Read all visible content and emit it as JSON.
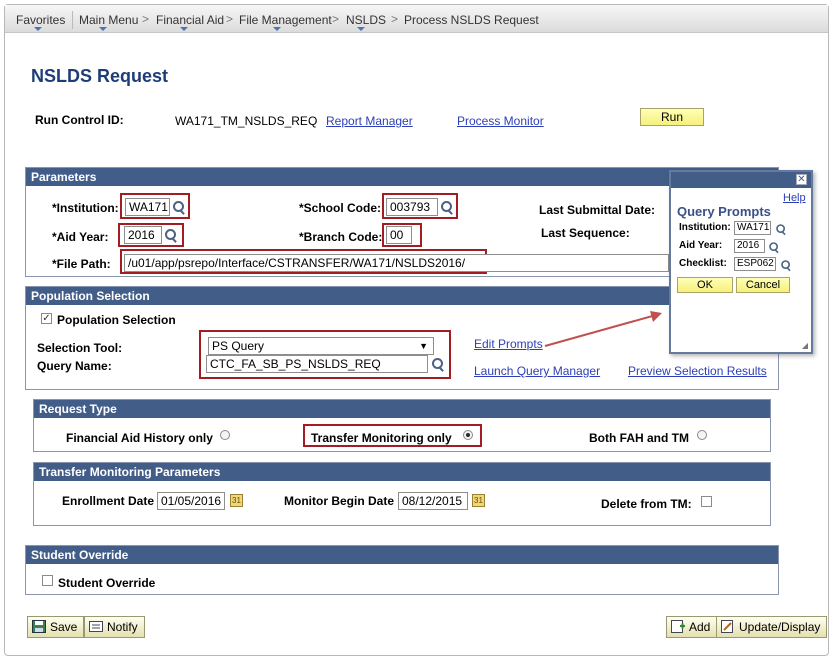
{
  "breadcrumb": {
    "items": [
      "Favorites",
      "Main Menu",
      "Financial Aid",
      "File Management",
      "NSLDS",
      "Process NSLDS Request"
    ],
    "separator": ">"
  },
  "page": {
    "title": "NSLDS Request"
  },
  "run_control": {
    "label": "Run Control ID:",
    "value": "WA171_TM_NSLDS_REQ",
    "report_manager": "Report Manager",
    "process_monitor": "Process Monitor",
    "run_button": "Run"
  },
  "parameters": {
    "header": "Parameters",
    "institution": {
      "label": "*Institution:",
      "value": "WA171"
    },
    "school_code": {
      "label": "*School Code:",
      "value": "003793"
    },
    "last_submittal_date": {
      "label": "Last Submittal Date:"
    },
    "aid_year": {
      "label": "*Aid Year:",
      "value": "2016"
    },
    "branch_code": {
      "label": "*Branch Code:",
      "value": "00"
    },
    "last_sequence": {
      "label": "Last Sequence:"
    },
    "file_path": {
      "label": "*File Path:",
      "value": "/u01/app/psrepo/Interface/CSTRANSFER/WA171/NSLDS2016/"
    }
  },
  "population": {
    "header": "Population Selection",
    "checkbox_label": "Population Selection",
    "checked": true,
    "selection_tool_label": "Selection Tool:",
    "selection_tool_value": "PS Query",
    "query_name_label": "Query Name:",
    "query_name_value": "CTC_FA_SB_PS_NSLDS_REQ",
    "edit_prompts": "Edit Prompts",
    "launch_query_manager": "Launch Query Manager",
    "preview_selection_results": "Preview Selection Results"
  },
  "request_type": {
    "header": "Request Type",
    "options": [
      {
        "label": "Financial Aid History only",
        "selected": false
      },
      {
        "label": "Transfer Monitoring only",
        "selected": true
      },
      {
        "label": "Both FAH and TM",
        "selected": false
      }
    ]
  },
  "tm_params": {
    "header": "Transfer Monitoring Parameters",
    "enrollment_date_label": "Enrollment Date",
    "enrollment_date_value": "01/05/2016",
    "monitor_begin_label": "Monitor Begin Date",
    "monitor_begin_value": "08/12/2015",
    "delete_label": "Delete from TM:"
  },
  "student_override": {
    "header": "Student Override",
    "checkbox_label": "Student Override",
    "checked": false
  },
  "footer": {
    "save": "Save",
    "notify": "Notify",
    "add": "Add",
    "update_display": "Update/Display"
  },
  "query_prompts": {
    "help": "Help",
    "title": "Query Prompts",
    "institution_label": "Institution:",
    "institution_value": "WA171",
    "aid_year_label": "Aid Year:",
    "aid_year_value": "2016",
    "checklist_label": "Checklist:",
    "checklist_value": "ESP062",
    "ok": "OK",
    "cancel": "Cancel"
  },
  "colors": {
    "section_header": "#435d89",
    "highlight_box": "#a21d22",
    "title": "#1e3d78",
    "link": "#2c3fb8"
  }
}
